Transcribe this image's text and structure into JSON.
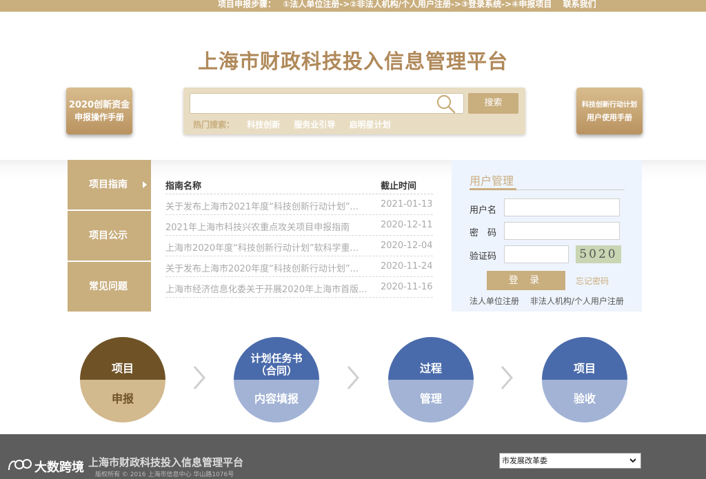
{
  "topbar": {
    "steps_label": "项目申报步骤：",
    "step1": "①法人单位注册->",
    "step2": "②非法人机构/个人用户注册->",
    "step3": "③登录系统->",
    "step4": "④申报项目",
    "contact": "联系我们"
  },
  "header": {
    "site_title": "上海市财政科技投入信息管理平台",
    "manual_left": {
      "line1": "2020创新资金",
      "line2": "申报操作手册"
    },
    "manual_right": {
      "line1": "科技创新行动计划",
      "line2": "用户使用手册"
    }
  },
  "search": {
    "placeholder": "",
    "button": "搜索",
    "hot_label": "热门搜索：",
    "hot_items": [
      "科技创新",
      "服务业引导",
      "启明星计划"
    ]
  },
  "tabs": [
    {
      "label": "项目指南",
      "active": true
    },
    {
      "label": "项目公示",
      "active": false
    },
    {
      "label": "常见问题",
      "active": false
    }
  ],
  "guide": {
    "col_name": "指南名称",
    "col_deadline": "截止时间",
    "rows": [
      {
        "title": "关于发布上海市2021年度“科技创新行动计划”...",
        "date": "2021-01-13"
      },
      {
        "title": "2021年上海市科技兴农重点攻关项目申报指南",
        "date": "2020-12-11"
      },
      {
        "title": "上海市2020年度“科技创新行动计划”软科学重...",
        "date": "2020-12-04"
      },
      {
        "title": "关于发布上海市2020年度“科技创新行动计划”...",
        "date": "2020-11-24"
      },
      {
        "title": "上海市经济信息化委关于开展2020年上海市首版...",
        "date": "2020-11-16"
      }
    ]
  },
  "user_panel": {
    "title": "用户管理",
    "username_label": "用户名",
    "password_label": "密　码",
    "captcha_label": "验证码",
    "captcha_text": "5020",
    "login_button": "登 录",
    "forgot": "忘记密码",
    "reg_org": "法人单位注册",
    "reg_person": "非法人机构/个人用户注册"
  },
  "process": [
    {
      "top": "项目",
      "bottom": "申报"
    },
    {
      "top": "计划任务书\n（合同）",
      "bottom": "内容填报"
    },
    {
      "top": "过程",
      "bottom": "管理"
    },
    {
      "top": "项目",
      "bottom": "验收"
    }
  ],
  "footer": {
    "title": "上海市财政科技投入信息管理平台",
    "copyright": "版权所有 © 2016 上海市信息中心 华山路1076号",
    "select_value": "市发展改革委"
  },
  "watermark": {
    "text": "大数跨境"
  },
  "colors": {
    "accent": "#c9ae7e",
    "title": "#b0895a",
    "dark_brown": "#6f5326",
    "blue": "#4a6bab",
    "light_blue": "#a2b3d5",
    "panel_bg": "#eef4fd",
    "footer_bg": "#5d5d5d"
  }
}
